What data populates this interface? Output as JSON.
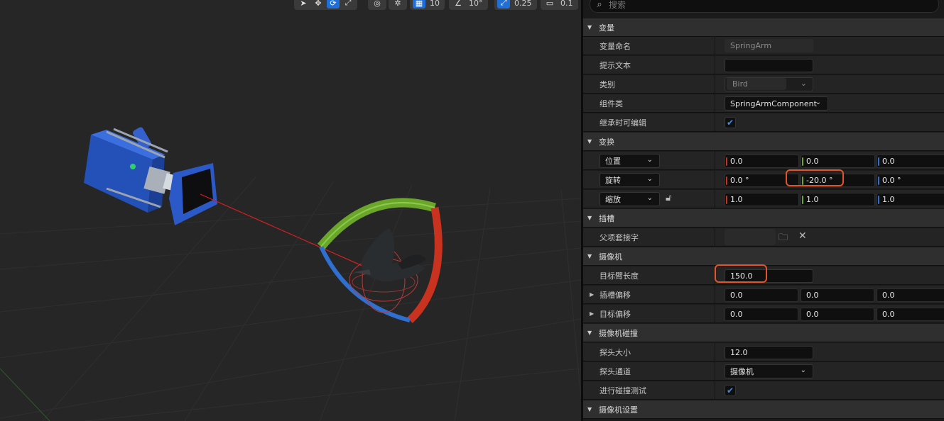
{
  "toolbar": {
    "grid_value": "10",
    "angle_value": "10°",
    "scale_value": "0.25",
    "camera_speed": "0.1"
  },
  "search": {
    "placeholder": "搜索"
  },
  "categories": {
    "variable": "变量",
    "transform": "变换",
    "socket": "插槽",
    "camera": "摄像机",
    "camera_collision": "摄像机碰撞",
    "camera_settings": "摄像机设置"
  },
  "variable": {
    "name_label": "变量命名",
    "name_value": "SpringArm",
    "tooltip_label": "提示文本",
    "tooltip_value": "",
    "category_label": "类别",
    "category_value": "Bird",
    "component_class_label": "组件类",
    "component_class_value": "SpringArmComponent",
    "editable_label": "继承时可编辑",
    "editable_checked": true
  },
  "transform": {
    "location_label": "位置",
    "location": [
      "0.0",
      "0.0",
      "0.0"
    ],
    "rotation_label": "旋转",
    "rotation": [
      "0.0 °",
      "-20.0 °",
      "0.0 °"
    ],
    "scale_label": "缩放",
    "scale": [
      "1.0",
      "1.0",
      "1.0"
    ]
  },
  "socket": {
    "parent_socket_label": "父项套接字",
    "parent_socket_value": ""
  },
  "camera": {
    "arm_length_label": "目标臂长度",
    "arm_length_value": "150.0",
    "socket_offset_label": "插槽偏移",
    "socket_offset": [
      "0.0",
      "0.0",
      "0.0"
    ],
    "target_offset_label": "目标偏移",
    "target_offset": [
      "0.0",
      "0.0",
      "0.0"
    ]
  },
  "camera_collision": {
    "probe_size_label": "探头大小",
    "probe_size_value": "12.0",
    "probe_channel_label": "探头通道",
    "probe_channel_value": "摄像机",
    "do_collision_label": "进行碰撞测试",
    "do_collision_checked": true
  },
  "colors": {
    "x_axis": "#c8321e",
    "y_axis": "#6aa62a",
    "z_axis": "#2f6fd0",
    "accent": "#1f6fd6",
    "highlight": "#e2542a"
  }
}
